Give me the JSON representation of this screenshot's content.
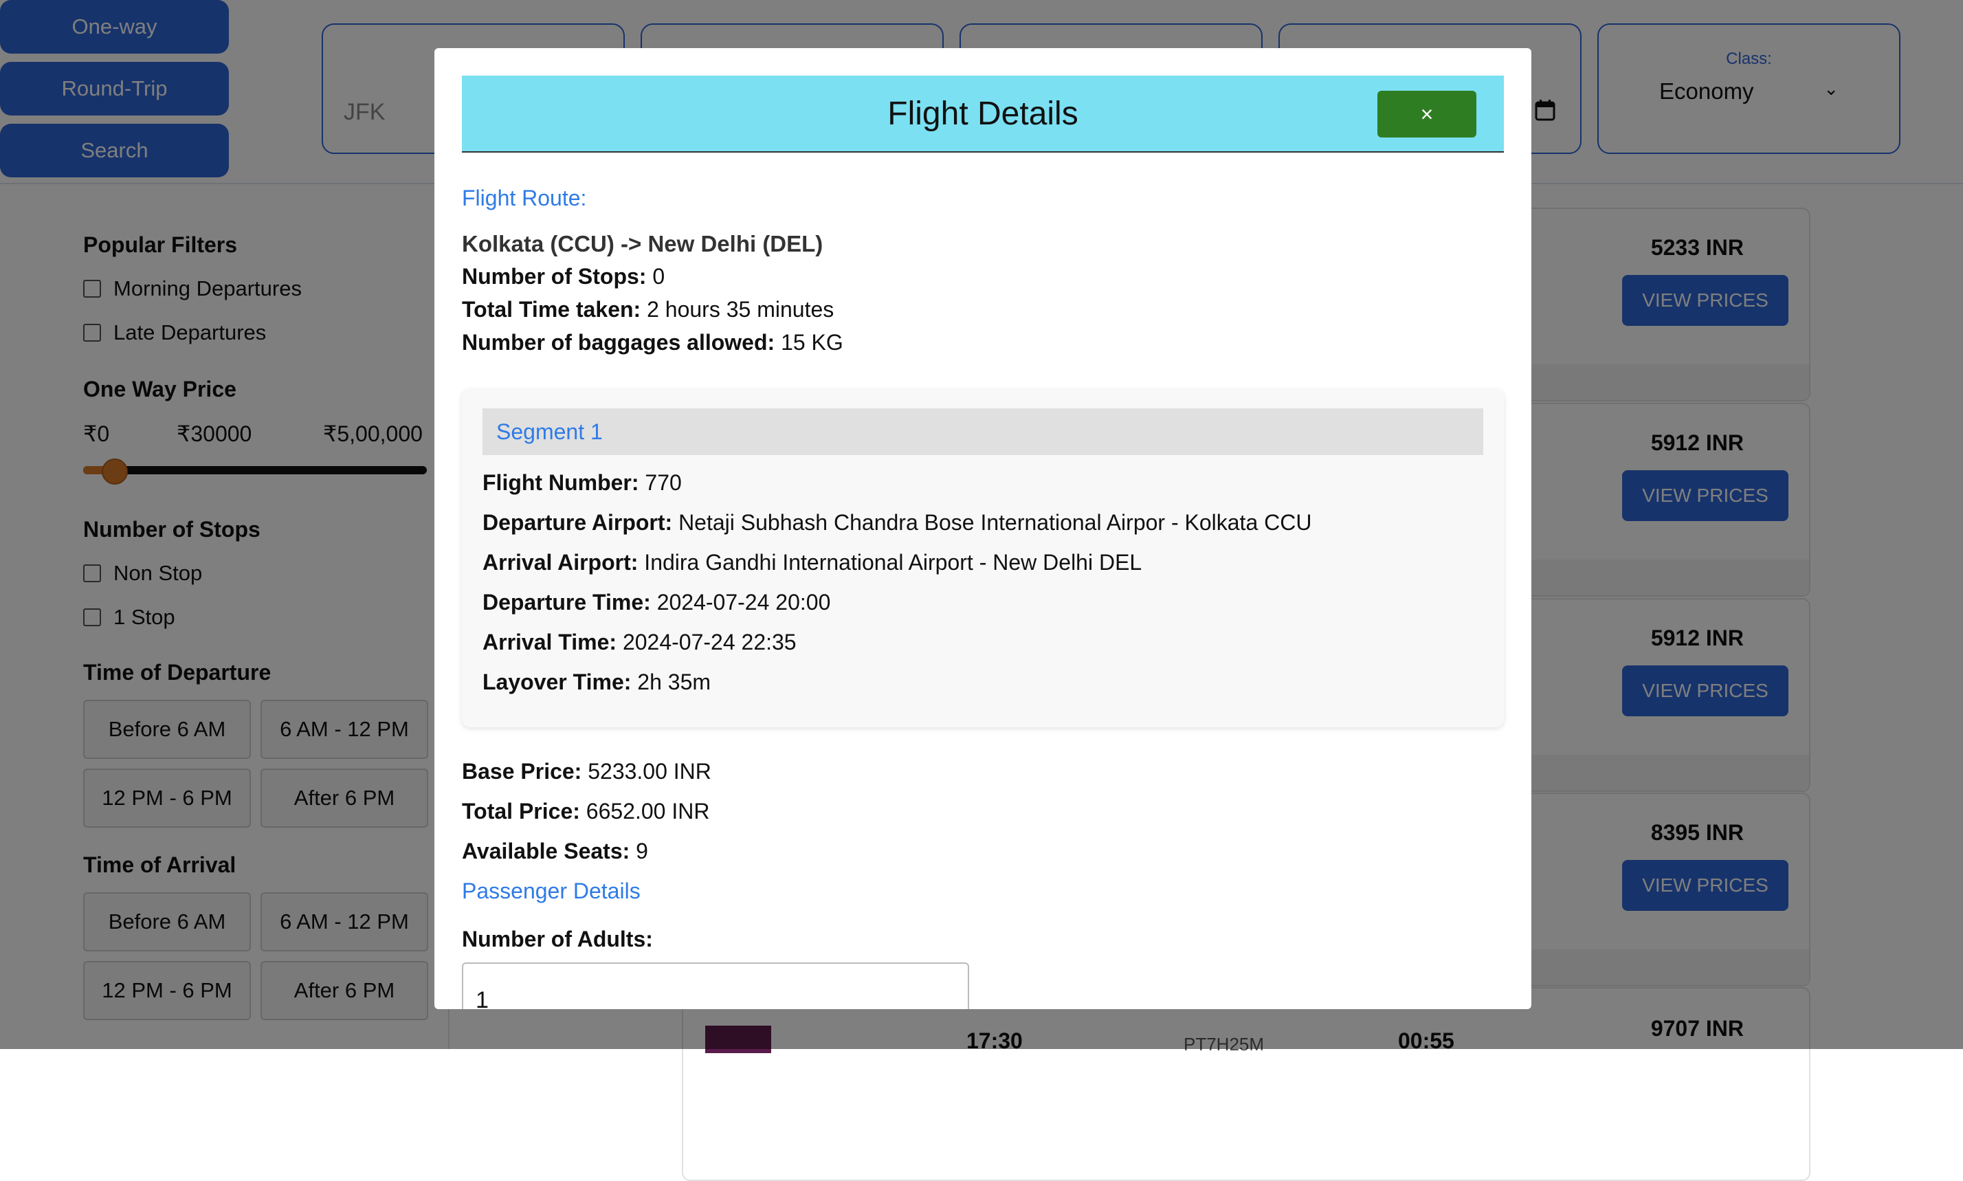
{
  "trip_modes": [
    "One-way",
    "Round-Trip",
    "Search"
  ],
  "search": {
    "from_value": "JFK",
    "class_label": "Class:",
    "class_value": "Economy"
  },
  "filters": {
    "popular_title": "Popular Filters",
    "popular_items": [
      "Morning Departures",
      "Late Departures"
    ],
    "price_title": "One Way Price",
    "price_min": "₹0",
    "price_current": "₹30000",
    "price_max": "₹5,00,000",
    "price_level_fraction": 0.06,
    "stops_title": "Number of Stops",
    "stops_items": [
      "Non Stop",
      "1 Stop"
    ],
    "departure_title": "Time of Departure",
    "departure_slots": [
      "Before 6 AM",
      "6 AM - 12 PM",
      "12 PM - 6 PM",
      "After 6 PM"
    ],
    "arrival_title": "Time of Arrival",
    "arrival_slots": [
      "Before 6 AM",
      "6 AM - 12 PM",
      "12 PM - 6 PM",
      "After 6 PM"
    ]
  },
  "results": [
    {
      "price": "5233 INR",
      "button": "VIEW PRICES"
    },
    {
      "price": "5912 INR",
      "button": "VIEW PRICES"
    },
    {
      "price": "5912 INR",
      "button": "VIEW PRICES"
    },
    {
      "price": "8395 INR",
      "button": "VIEW PRICES"
    }
  ],
  "peek_row": {
    "departure": "17:30",
    "code": "PT7H25M",
    "arrival": "00:55",
    "price": "9707 INR"
  },
  "modal": {
    "title": "Flight Details",
    "close": "×",
    "route_heading": "Flight Route:",
    "route": "Kolkata (CCU) -> New Delhi (DEL)",
    "stops_label": "Number of Stops:",
    "stops_value": "0",
    "time_label": "Total Time taken:",
    "time_value": "2 hours 35 minutes",
    "baggage_label": "Number of baggages allowed:",
    "baggage_value": "15 KG",
    "segment": {
      "heading": "Segment 1",
      "flight_number_label": "Flight Number:",
      "flight_number": "770",
      "departure_airport_label": "Departure Airport:",
      "departure_airport": "Netaji Subhash Chandra Bose International Airpor - Kolkata CCU",
      "arrival_airport_label": "Arrival Airport:",
      "arrival_airport": "Indira Gandhi International Airport - New Delhi DEL",
      "departure_time_label": "Departure Time:",
      "departure_time": "2024-07-24 20:00",
      "arrival_time_label": "Arrival Time:",
      "arrival_time": "2024-07-24 22:35",
      "layover_label": "Layover Time:",
      "layover": "2h 35m"
    },
    "base_price_label": "Base Price:",
    "base_price": "5233.00 INR",
    "total_price_label": "Total Price:",
    "total_price": "6652.00 INR",
    "seats_label": "Available Seats:",
    "seats": "9",
    "passenger_heading": "Passenger Details",
    "adults_label": "Number of Adults:",
    "adults_value": "1"
  }
}
